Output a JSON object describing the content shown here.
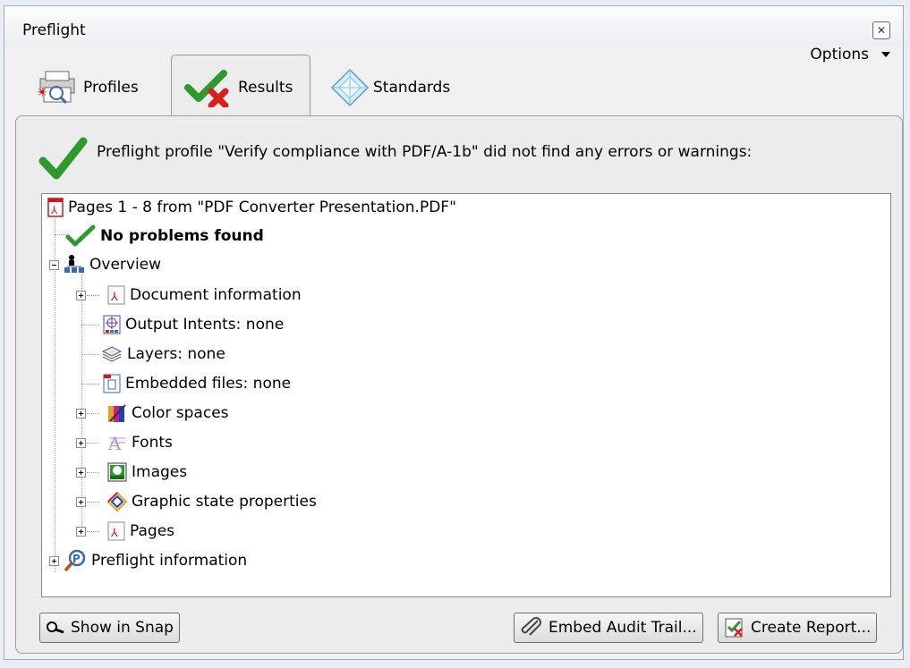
{
  "window": {
    "title": "Preflight"
  },
  "tabs": [
    {
      "label": "Profiles"
    },
    {
      "label": "Results"
    },
    {
      "label": "Standards"
    }
  ],
  "options_label": "Options",
  "status": {
    "message": "Preflight profile \"Verify compliance with PDF/A-1b\" did not find any errors or warnings:"
  },
  "tree": {
    "root": "Pages 1 - 8 from \"PDF Converter Presentation.PDF\"",
    "no_problems": "No problems found",
    "overview": "Overview",
    "children": [
      {
        "label": "Document information",
        "icon": "pdf-icon"
      },
      {
        "label": "Output Intents: none",
        "icon": "output-intent-icon"
      },
      {
        "label": "Layers: none",
        "icon": "layers-icon"
      },
      {
        "label": "Embedded files: none",
        "icon": "embedded-file-icon"
      },
      {
        "label": "Color spaces",
        "icon": "color-spaces-icon"
      },
      {
        "label": "Fonts",
        "icon": "fonts-icon"
      },
      {
        "label": "Images",
        "icon": "image-icon"
      },
      {
        "label": "Graphic state properties",
        "icon": "graphic-state-icon"
      },
      {
        "label": "Pages",
        "icon": "pdf-icon"
      }
    ],
    "preflight_info": "Preflight information"
  },
  "buttons": {
    "show_in_snap": "Show in Snap",
    "embed_audit_trail": "Embed Audit Trail...",
    "create_report": "Create Report..."
  },
  "colors": {
    "check_green": "#2e9a2e",
    "cross_red": "#d42020",
    "pdf_red": "#d0151b"
  }
}
